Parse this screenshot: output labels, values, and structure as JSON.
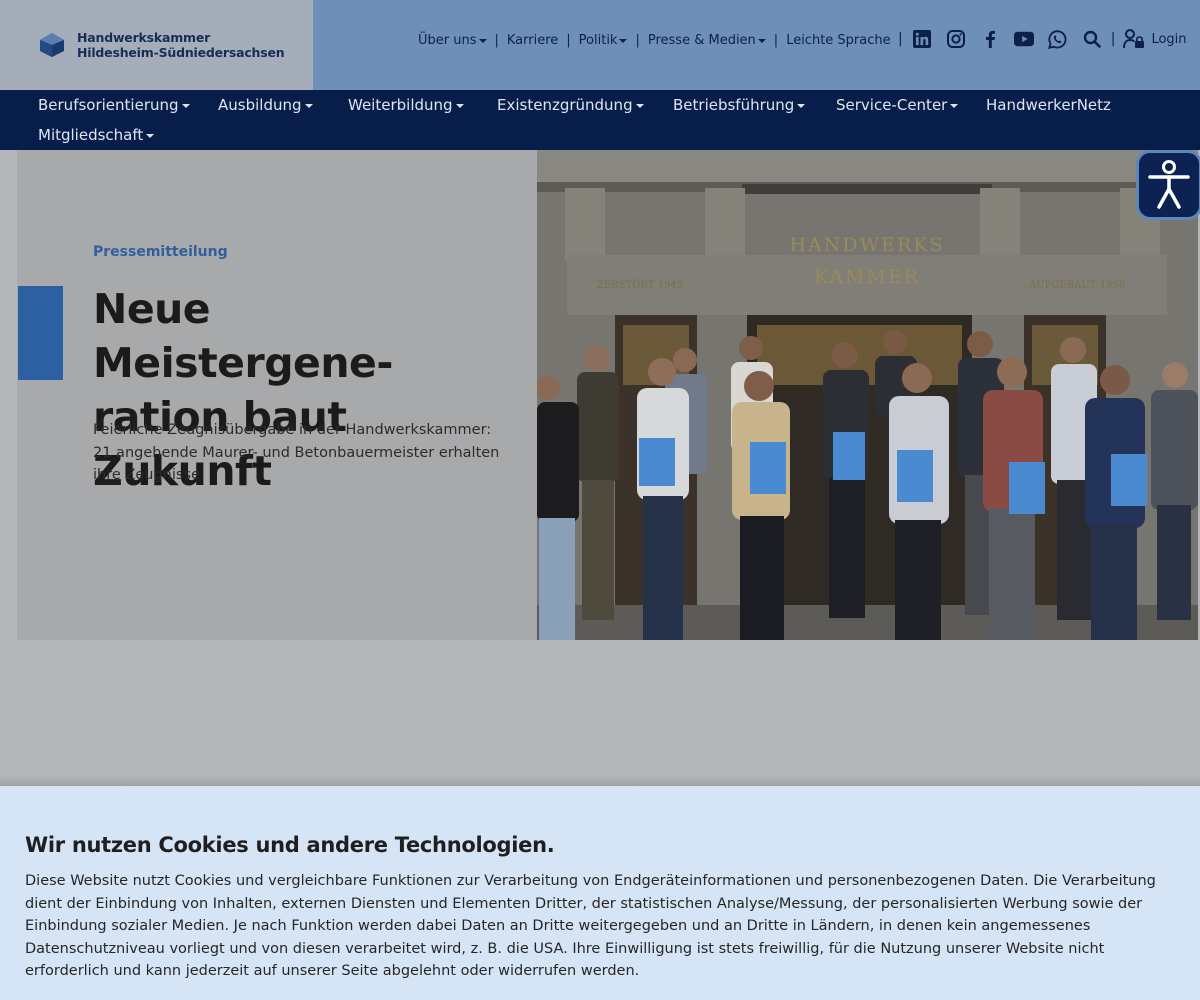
{
  "brand": {
    "line1": "Handwerkskammer",
    "line2": "Hildesheim-Südniedersachsen"
  },
  "topnav": {
    "items": [
      {
        "label": "Über uns",
        "dropdown": true
      },
      {
        "label": "Karriere",
        "dropdown": false
      },
      {
        "label": "Politik",
        "dropdown": true
      },
      {
        "label": "Presse & Medien",
        "dropdown": true
      },
      {
        "label": "Leichte Sprache",
        "dropdown": false
      }
    ],
    "login_label": "Login",
    "social_icons": [
      "linkedin-icon",
      "instagram-icon",
      "facebook-icon",
      "youtube-icon",
      "whatsapp-icon",
      "search-icon"
    ]
  },
  "mainnav": {
    "items": [
      {
        "label": "Berufsorientierung",
        "dropdown": true
      },
      {
        "label": "Ausbildung",
        "dropdown": true
      },
      {
        "label": "Weiterbildung",
        "dropdown": true
      },
      {
        "label": "Existenzgründung",
        "dropdown": true
      },
      {
        "label": "Betriebsführung",
        "dropdown": true
      },
      {
        "label": "Service-Center",
        "dropdown": true
      },
      {
        "label": "HandwerkerNetz",
        "dropdown": false
      },
      {
        "label": "Mitgliedschaft",
        "dropdown": true
      }
    ]
  },
  "hero": {
    "kicker": "Pressemitteilung",
    "title_line1": "Neue Meistergene-",
    "title_line2": "ration baut Zukunft",
    "subtitle": "Feierliche Zeugnisübergabe in der Handwerkskammer: 21 angehende Maurer- und Betonbauermeister erhalten ihre Zeugnisse.",
    "building_sign_line1": "HANDWERKS",
    "building_sign_line2": "KAMMER",
    "plaque_left": "ZERSTÖRT 1945",
    "plaque_right": "AUFGEBAUT 1958"
  },
  "cookie": {
    "title": "Wir nutzen Cookies und andere Technologien.",
    "text": "Diese Website nutzt Cookies und vergleichbare Funktionen zur Verarbeitung von Endgeräteinformationen und personenbezogenen Daten. Die Verarbeitung dient der Einbindung von Inhalten, externen Diensten und Elementen Dritter, der statistischen Analyse/Messung, der personalisierten Werbung sowie der Einbindung sozialer Medien. Je nach Funktion werden dabei Daten an Dritte weitergegeben und an Dritte in Ländern, in denen kein angemessenes Datenschutzniveau vorliegt und von diesen verarbeitet wird, z. B. die USA. Ihre Einwilligung ist stets freiwillig, für die Nutzung unserer Website nicht erforderlich und kann jederzeit auf unserer Seite abgelehnt oder widerrufen werden."
  },
  "colors": {
    "nav_dark": "#071e4b",
    "accent_blue": "#2d5fa3",
    "cookie_bg": "#d6e5f6"
  }
}
